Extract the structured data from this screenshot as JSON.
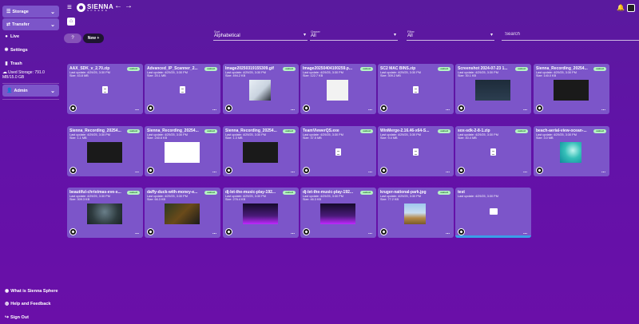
{
  "app": {
    "logo_line1": "SIENNA",
    "logo_line2": "SPHERE"
  },
  "sidebar": {
    "storage_label": "Storage",
    "transfer_label": "Transfer",
    "items": [
      {
        "label": "Live",
        "icon": "chat-icon"
      },
      {
        "label": "Settings",
        "icon": "gear-icon"
      },
      {
        "label": "Trash",
        "icon": "trash-icon"
      }
    ],
    "used_storage": "Used Storage: 791.0 MB/15.0 GB",
    "admin_label": "Admin"
  },
  "toolbar": {
    "help_label": "?",
    "new_label": "New +",
    "sort": {
      "label": "Sort",
      "value": "Alphabetical"
    },
    "owner": {
      "label": "Owner",
      "value": "All"
    },
    "filter": {
      "label": "Filter",
      "value": "All"
    },
    "search_placeholder": "Search"
  },
  "cards": [
    {
      "name": "AAX_SDK_v_2.70.zip",
      "update": "Last update: 4/29/25, 3:30 PM",
      "size": "Size: 43.8 MB",
      "badge": "owned",
      "thumb": "file"
    },
    {
      "name": "Advanced_IP_Scanner_2...",
      "update": "Last update: 4/29/25, 3:30 PM",
      "size": "Size: 20.1 MB",
      "badge": "owned",
      "thumb": "file"
    },
    {
      "name": "Image20250319155309.gif",
      "update": "Last update: 4/29/25, 3:30 PM",
      "size": "Size: 494.2 KB",
      "badge": "owned",
      "thumb": "desk"
    },
    {
      "name": "Image20250404100259.p...",
      "update": "Last update: 4/29/25, 3:30 PM",
      "size": "Size: 122.7 KB",
      "badge": "owned",
      "thumb": "phone"
    },
    {
      "name": "SC2 MAC BINS.zip",
      "update": "Last update: 4/29/25, 3:30 PM",
      "size": "Size: 309.2 MB",
      "badge": "owned",
      "thumb": "file"
    },
    {
      "name": "Screenshot 2024-07-23 1...",
      "update": "Last update: 4/29/25, 3:30 PM",
      "size": "Size: 30.1 KB",
      "badge": "owned",
      "thumb": "code"
    },
    {
      "name": "Sienna_Recording_20254...",
      "update": "Last update: 4/29/25, 3:30 PM",
      "size": "Size: 140.0 KB",
      "badge": "owned",
      "thumb": "dark"
    },
    {
      "name": "Sienna_Recording_20254...",
      "update": "Last update: 4/29/25, 3:30 PM",
      "size": "Size: 1.1 MB",
      "badge": "owned",
      "thumb": "dark"
    },
    {
      "name": "Sienna_Recording_20254...",
      "update": "Last update: 4/29/25, 3:30 PM",
      "size": "Size: 240.6 KB",
      "badge": "owned",
      "thumb": "white"
    },
    {
      "name": "Sienna_Recording_20254...",
      "update": "Last update: 4/29/25, 3:30 PM",
      "size": "Size: 1.3 MB",
      "badge": "owned",
      "thumb": "dark"
    },
    {
      "name": "TeamViewerQS.exe",
      "update": "Last update: 4/29/25, 3:30 PM",
      "size": "Size: 37.5 MB",
      "badge": "owned",
      "thumb": "file"
    },
    {
      "name": "WinMerge-2.16.46-x64-S...",
      "update": "Last update: 4/29/25, 3:30 PM",
      "size": "Size: 9.4 MB",
      "badge": "owned",
      "thumb": "file"
    },
    {
      "name": "sox-sdk-2-8-1.zip",
      "update": "Last update: 4/29/25, 3:30 PM",
      "size": "Size: 40.4 MB",
      "badge": "owned",
      "thumb": "file"
    },
    {
      "name": "beach-aerial-view-ocean-...",
      "update": "Last update: 4/29/25, 3:30 PM",
      "size": "Size: 3.0 MB",
      "badge": "owned",
      "thumb": "beach"
    },
    {
      "name": "beautiful-christmas-eve-s...",
      "update": "Last update: 4/29/25, 3:30 PM",
      "size": "Size: 309.3 KB",
      "badge": "owned",
      "thumb": "xmas"
    },
    {
      "name": "daffy-duck-with-money-e...",
      "update": "Last update: 4/29/25, 3:30 PM",
      "size": "Size: 66.3 KB",
      "badge": "owned",
      "thumb": "duck"
    },
    {
      "name": "dj-let-the-music-play-192...",
      "update": "Last update: 4/29/25, 3:30 PM",
      "size": "Size: 276.4 KB",
      "badge": "owned",
      "thumb": "car"
    },
    {
      "name": "dj-let-the-music-play-192...",
      "update": "Last update: 4/29/25, 3:30 PM",
      "size": "Size: 46.3 KB",
      "badge": "owned",
      "thumb": "car"
    },
    {
      "name": "kruger-national-park.jpg",
      "update": "Last update: 4/29/25, 3:30 PM",
      "size": "Size: 77.2 KB",
      "badge": "owned",
      "thumb": "park"
    },
    {
      "name": "test",
      "update": "Last update: 4/29/25, 3:30 PM",
      "size": "",
      "badge": "",
      "thumb": "folder"
    }
  ],
  "bottom": {
    "about": "What is Sienna Sphere",
    "help": "Help and Feedback",
    "signout": "Sign Out"
  },
  "colors": {
    "card": "#7c55c9",
    "badge": "#b4f3c2",
    "accent": "#3a9ee8"
  }
}
